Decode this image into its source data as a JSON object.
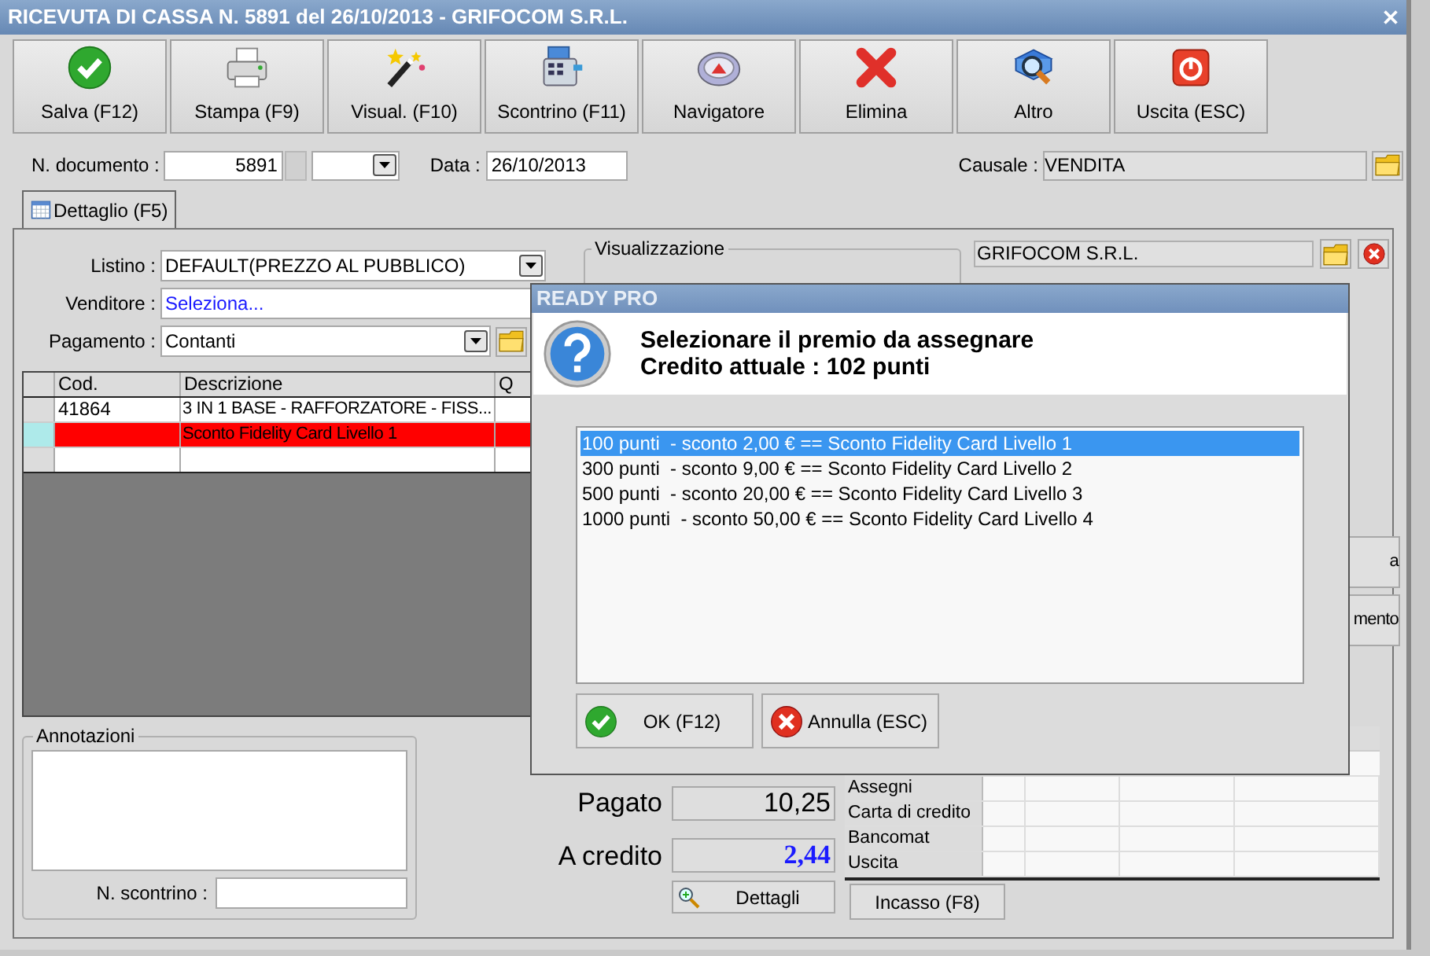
{
  "window": {
    "title": "RICEVUTA DI CASSA N. 5891 del 26/10/2013 - GRIFOCOM S.R.L."
  },
  "toolbar": [
    {
      "label": "Salva (F12)"
    },
    {
      "label": "Stampa (F9)"
    },
    {
      "label": "Visual. (F10)"
    },
    {
      "label": "Scontrino (F11)"
    },
    {
      "label": "Navigatore"
    },
    {
      "label": "Elimina"
    },
    {
      "label": "Altro"
    },
    {
      "label": "Uscita (ESC)"
    }
  ],
  "document": {
    "number_label": "N. documento :",
    "number": "5891",
    "date_label": "Data :",
    "date": "26/10/2013",
    "causale_label": "Causale :",
    "causale": "VENDITA"
  },
  "tabs": [
    {
      "label": "Dettaglio (F5)",
      "selected": true
    }
  ],
  "form": {
    "listino_label": "Listino :",
    "listino": "DEFAULT(PREZZO AL PUBBLICO)",
    "venditore_label": "Venditore :",
    "venditore": "Seleziona...",
    "pagamento_label": "Pagamento :",
    "pagamento": "Contanti",
    "visualizzazione_label": "Visualizzazione",
    "customer": "GRIFOCOM S.R.L."
  },
  "lines": {
    "columns": [
      "Cod.",
      "Descrizione",
      "Q"
    ],
    "rows": [
      {
        "cod": "41864",
        "description": "3 IN 1 BASE - RAFFORZATORE - FISS...",
        "kind": "item",
        "selected": false
      },
      {
        "description": "Sconto Fidelity Card Livello 1",
        "kind": "discount",
        "selected": true
      }
    ]
  },
  "side_buttons": [
    "a",
    "mento"
  ],
  "annotations": {
    "label": "Annotazioni",
    "receipt_label": "N. scontrino :"
  },
  "totals": [
    {
      "label": "Pagato",
      "value": "10,25",
      "kind": "normal"
    },
    {
      "label": "A credito",
      "value": "2,44",
      "kind": "credit"
    }
  ],
  "details_button": "Dettagli",
  "payments": [
    "Assegni",
    "Carta di credito",
    "Bancomat",
    "Uscita"
  ],
  "incasso_button": "Incasso (F8)",
  "dialog": {
    "title": "READY PRO",
    "message": "Selezionare il premio da assegnare",
    "credit": "Credito attuale : 102 punti",
    "options": [
      {
        "label": "100 punti  - sconto 2,00 € == Sconto Fidelity Card Livello 1",
        "selected": true
      },
      {
        "label": "300 punti  - sconto 9,00 € == Sconto Fidelity Card Livello 2",
        "selected": false
      },
      {
        "label": "500 punti  - sconto 20,00 € == Sconto Fidelity Card Livello 3",
        "selected": false
      },
      {
        "label": "1000 punti  - sconto 50,00 € == Sconto Fidelity Card Livello 4",
        "selected": false
      }
    ],
    "buttons": [
      {
        "label": "OK (F12)",
        "kind": "ok"
      },
      {
        "label": "Annulla (ESC)",
        "kind": "cancel"
      }
    ]
  }
}
